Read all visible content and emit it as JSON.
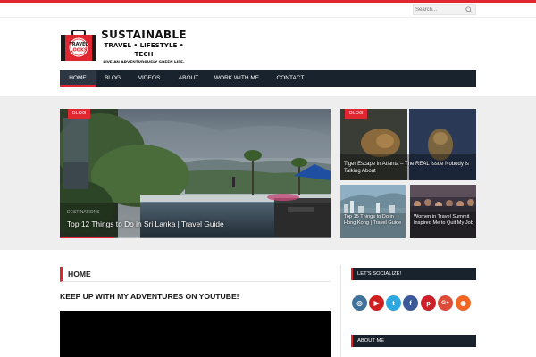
{
  "search": {
    "placeholder": "Search..."
  },
  "logo": {
    "badge_line1": "TRAVEL",
    "badge_line2": "LOOKS",
    "title": "SUSTAINABLE",
    "subtitle": "TRAVEL • LIFESTYLE • TECH",
    "tagline": "LIVE AN ADVENTUROUSLY GREEN LIFE."
  },
  "nav": {
    "items": [
      {
        "label": "HOME"
      },
      {
        "label": "BLOG"
      },
      {
        "label": "VIDEOS"
      },
      {
        "label": "ABOUT"
      },
      {
        "label": "WORK WITH ME"
      },
      {
        "label": "CONTACT"
      }
    ]
  },
  "featured": {
    "main": {
      "tag": "BLOG",
      "category": "Destinations",
      "title": "Top 12 Things to Do in Sri Lanka | Travel Guide"
    },
    "tiger": {
      "tag": "BLOG",
      "title": "Tiger Escape in Atlanta – The REAL Issue Nobody is Talking About"
    },
    "hongkong": {
      "title": "Top 15 Things to Do in Hong Kong | Travel Guide"
    },
    "women": {
      "title": "Women in Travel Summit Inspired Me to Quit My Job"
    }
  },
  "main": {
    "section_heading": "HOME",
    "youtube_title": "KEEP UP WITH MY ADVENTURES ON YOUTUBE!"
  },
  "sidebar": {
    "socialize_heading": "LET'S SOCIALIZE!",
    "about_heading": "ABOUT ME",
    "social_icons": [
      {
        "name": "instagram",
        "glyph": "◎",
        "color": "#3f729b"
      },
      {
        "name": "youtube",
        "glyph": "▶",
        "color": "#cd201f"
      },
      {
        "name": "twitter",
        "glyph": "t",
        "color": "#2ca7e0"
      },
      {
        "name": "facebook",
        "glyph": "f",
        "color": "#3b5998"
      },
      {
        "name": "pinterest",
        "glyph": "p",
        "color": "#cb2027"
      },
      {
        "name": "google-plus",
        "glyph": "G+",
        "color": "#dd4b39"
      },
      {
        "name": "rss",
        "glyph": "◉",
        "color": "#f26522"
      }
    ]
  },
  "colors": {
    "accent": "#e0262f",
    "nav_bg": "#19232d"
  }
}
